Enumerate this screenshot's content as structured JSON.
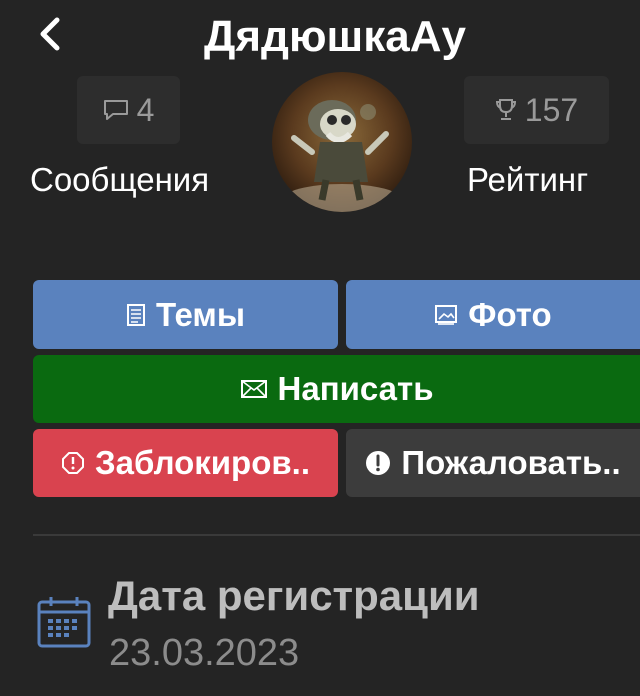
{
  "header": {
    "title": "ДядюшкаАу",
    "back_icon": "chevron-left-icon"
  },
  "stats": {
    "messages": {
      "count": "4",
      "label": "Сообщения",
      "icon": "comment-icon"
    },
    "rating": {
      "count": "157",
      "label": "Рейтинг",
      "icon": "trophy-icon"
    }
  },
  "avatar": {
    "icon": "avatar-photo"
  },
  "actions": {
    "topics": {
      "label": "Темы",
      "icon": "document-icon",
      "color": "#5a82be"
    },
    "photo": {
      "label": "Фото",
      "icon": "image-icon",
      "color": "#5a82be"
    },
    "write": {
      "label": "Написать",
      "icon": "envelope-icon",
      "color": "#0a6a10"
    },
    "block": {
      "label": "Заблокиров..",
      "icon": "ban-icon",
      "color": "#d9434f"
    },
    "report": {
      "label": "Пожаловать..",
      "icon": "exclamation-circle-icon",
      "color": "#3c3c3c"
    }
  },
  "registration": {
    "label": "Дата регистрации",
    "date": "23.03.2023",
    "icon": "calendar-icon"
  }
}
